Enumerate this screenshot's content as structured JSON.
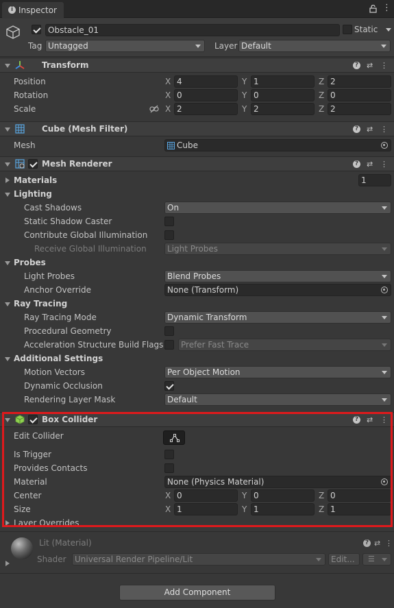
{
  "tab": {
    "title": "Inspector"
  },
  "gameobject": {
    "name": "Obstacle_01",
    "static_label": "Static",
    "tag_label": "Tag",
    "tag_value": "Untagged",
    "layer_label": "Layer",
    "layer_value": "Default"
  },
  "transform": {
    "title": "Transform",
    "position_label": "Position",
    "rotation_label": "Rotation",
    "scale_label": "Scale",
    "axis_x": "X",
    "axis_y": "Y",
    "axis_z": "Z",
    "position": {
      "x": "4",
      "y": "1",
      "z": "2"
    },
    "rotation": {
      "x": "0",
      "y": "0",
      "z": "0"
    },
    "scale": {
      "x": "2",
      "y": "2",
      "z": "2"
    }
  },
  "mesh_filter": {
    "title": "Cube (Mesh Filter)",
    "mesh_label": "Mesh",
    "mesh_value": "Cube"
  },
  "mesh_renderer": {
    "title": "Mesh Renderer",
    "materials_label": "Materials",
    "materials_count": "1",
    "lighting_label": "Lighting",
    "cast_shadows_label": "Cast Shadows",
    "cast_shadows_value": "On",
    "static_shadow_caster_label": "Static Shadow Caster",
    "contribute_gi_label": "Contribute Global Illumination",
    "receive_gi_label": "Receive Global Illumination",
    "receive_gi_value": "Light Probes",
    "probes_label": "Probes",
    "light_probes_label": "Light Probes",
    "light_probes_value": "Blend Probes",
    "anchor_override_label": "Anchor Override",
    "anchor_override_value": "None (Transform)",
    "ray_tracing_label": "Ray Tracing",
    "ray_tracing_mode_label": "Ray Tracing Mode",
    "ray_tracing_mode_value": "Dynamic Transform",
    "procedural_geometry_label": "Procedural Geometry",
    "accel_flags_label": "Acceleration Structure Build Flags",
    "accel_flags_value": "Prefer Fast Trace",
    "additional_settings_label": "Additional Settings",
    "motion_vectors_label": "Motion Vectors",
    "motion_vectors_value": "Per Object Motion",
    "dynamic_occlusion_label": "Dynamic Occlusion",
    "rendering_layer_mask_label": "Rendering Layer Mask",
    "rendering_layer_mask_value": "Default"
  },
  "box_collider": {
    "title": "Box Collider",
    "edit_collider_label": "Edit Collider",
    "is_trigger_label": "Is Trigger",
    "provides_contacts_label": "Provides Contacts",
    "material_label": "Material",
    "material_value": "None (Physics Material)",
    "center_label": "Center",
    "size_label": "Size",
    "center": {
      "x": "0",
      "y": "0",
      "z": "0"
    },
    "size": {
      "x": "1",
      "y": "1",
      "z": "1"
    },
    "layer_overrides_label": "Layer Overrides"
  },
  "material": {
    "title": "Lit (Material)",
    "shader_label": "Shader",
    "shader_value": "Universal Render Pipeline/Lit",
    "edit_label": "Edit..."
  },
  "add_component_label": "Add Component",
  "colors": {
    "highlight": "#e0191c",
    "collider_icon": "#8fd14f",
    "axis_x": "#e0463c",
    "axis_y": "#8fd14f",
    "axis_z": "#3e8ee8"
  }
}
